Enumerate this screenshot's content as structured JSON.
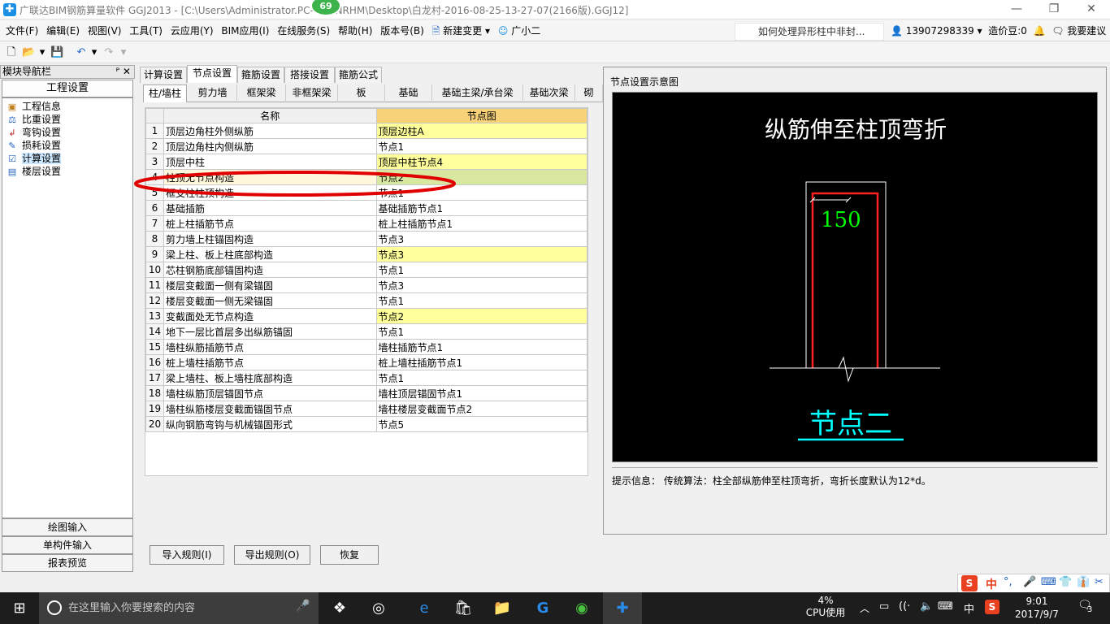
{
  "titlebar": {
    "title": "广联达BIM钢筋算量软件 GGJ2013 - [C:\\Users\\Administrator.PC-          127NRHM\\Desktop\\白龙村-2016-08-25-13-27-07(2166版).GGJ12]",
    "badge": "69",
    "minimize": "—",
    "restore": "❐",
    "close": "✕"
  },
  "menubar": {
    "items": [
      "文件(F)",
      "编辑(E)",
      "视图(V)",
      "工具(T)",
      "云应用(Y)",
      "BIM应用(I)",
      "在线服务(S)",
      "帮助(H)",
      "版本号(B)",
      "新建变更",
      "广小二"
    ],
    "help_link": "如何处理异形柱中非封...",
    "phone": "13907298339",
    "credits": "造价豆:0",
    "suggest": "我要建议"
  },
  "nav": {
    "header": "模块导航栏",
    "pin": "ᴾ ✕",
    "section": "工程设置",
    "items": [
      "工程信息",
      "比重设置",
      "弯钩设置",
      "损耗设置",
      "计算设置",
      "楼层设置"
    ],
    "bottom_buttons": [
      "绘图输入",
      "单构件输入",
      "报表预览"
    ]
  },
  "tabs": [
    "计算设置",
    "节点设置",
    "箍筋设置",
    "搭接设置",
    "箍筋公式"
  ],
  "subtabs": [
    "柱/墙柱",
    "剪力墙",
    "框架梁",
    "非框架梁",
    "板",
    "基础",
    "基础主梁/承台梁",
    "基础次梁",
    "砌"
  ],
  "grid": {
    "headers": [
      "名称",
      "节点图"
    ],
    "rows": [
      {
        "n": "1",
        "name": "顶层边角柱外侧纵筋",
        "node": "顶层边柱A"
      },
      {
        "n": "2",
        "name": "顶层边角柱内侧纵筋",
        "node": "节点1"
      },
      {
        "n": "3",
        "name": "顶层中柱",
        "node": "顶层中柱节点4"
      },
      {
        "n": "4",
        "name": "柱顶无节点构造",
        "node": "节点2"
      },
      {
        "n": "5",
        "name": "框支柱柱顶构造",
        "node": "节点1"
      },
      {
        "n": "6",
        "name": "基础插筋",
        "node": "基础插筋节点1"
      },
      {
        "n": "7",
        "name": "桩上柱插筋节点",
        "node": "桩上柱插筋节点1"
      },
      {
        "n": "8",
        "name": "剪力墙上柱锚固构造",
        "node": "节点3"
      },
      {
        "n": "9",
        "name": "梁上柱、板上柱底部构造",
        "node": "节点3"
      },
      {
        "n": "10",
        "name": "芯柱钢筋底部锚固构造",
        "node": "节点1"
      },
      {
        "n": "11",
        "name": "楼层变截面一侧有梁锚固",
        "node": "节点3"
      },
      {
        "n": "12",
        "name": "楼层变截面一侧无梁锚固",
        "node": "节点1"
      },
      {
        "n": "13",
        "name": "变截面处无节点构造",
        "node": "节点2"
      },
      {
        "n": "14",
        "name": "地下一层比首层多出纵筋锚固",
        "node": "节点1"
      },
      {
        "n": "15",
        "name": "墙柱纵筋插筋节点",
        "node": "墙柱插筋节点1"
      },
      {
        "n": "16",
        "name": "桩上墙柱插筋节点",
        "node": "桩上墙柱插筋节点1"
      },
      {
        "n": "17",
        "name": "梁上墙柱、板上墙柱底部构造",
        "node": "节点1"
      },
      {
        "n": "18",
        "name": "墙柱纵筋顶层锚固节点",
        "node": "墙柱顶层锚固节点1"
      },
      {
        "n": "19",
        "name": "墙柱纵筋楼层变截面锚固节点",
        "node": "墙柱楼层变截面节点2"
      },
      {
        "n": "20",
        "name": "纵向钢筋弯钩与机械锚固形式",
        "node": "节点5"
      }
    ]
  },
  "buttons": {
    "import": "导入规则(I)",
    "export": "导出规则(O)",
    "restore": "恢复"
  },
  "diagram_panel": {
    "title": "节点设置示意图",
    "heading": "纵筋伸至柱顶弯折",
    "dimension": "150",
    "node_label": "节点二",
    "hint": "提示信息：  传统算法：柱全部纵筋伸至柱顶弯折，弯折长度默认为12*d。"
  },
  "ime": {
    "items": [
      "S",
      "中",
      "°,",
      "🎤",
      "⌨",
      "👕",
      "👔",
      "✂"
    ]
  },
  "taskbar": {
    "search_placeholder": "在这里输入你要搜索的内容",
    "cpu_percent": "4%",
    "cpu_label": "CPU使用",
    "lang": "中",
    "time": "9:01",
    "date": "2017/9/7",
    "notif_count": "3"
  },
  "colors": {
    "highlight": "#ffff9c",
    "selected_node": "#d8e8a0",
    "header_node": "#f7d279",
    "annotation_ellipse": "#e00000",
    "diagram_heading": "#ffffff",
    "dimension_text": "#00ff00",
    "node_label": "#00ffff"
  }
}
